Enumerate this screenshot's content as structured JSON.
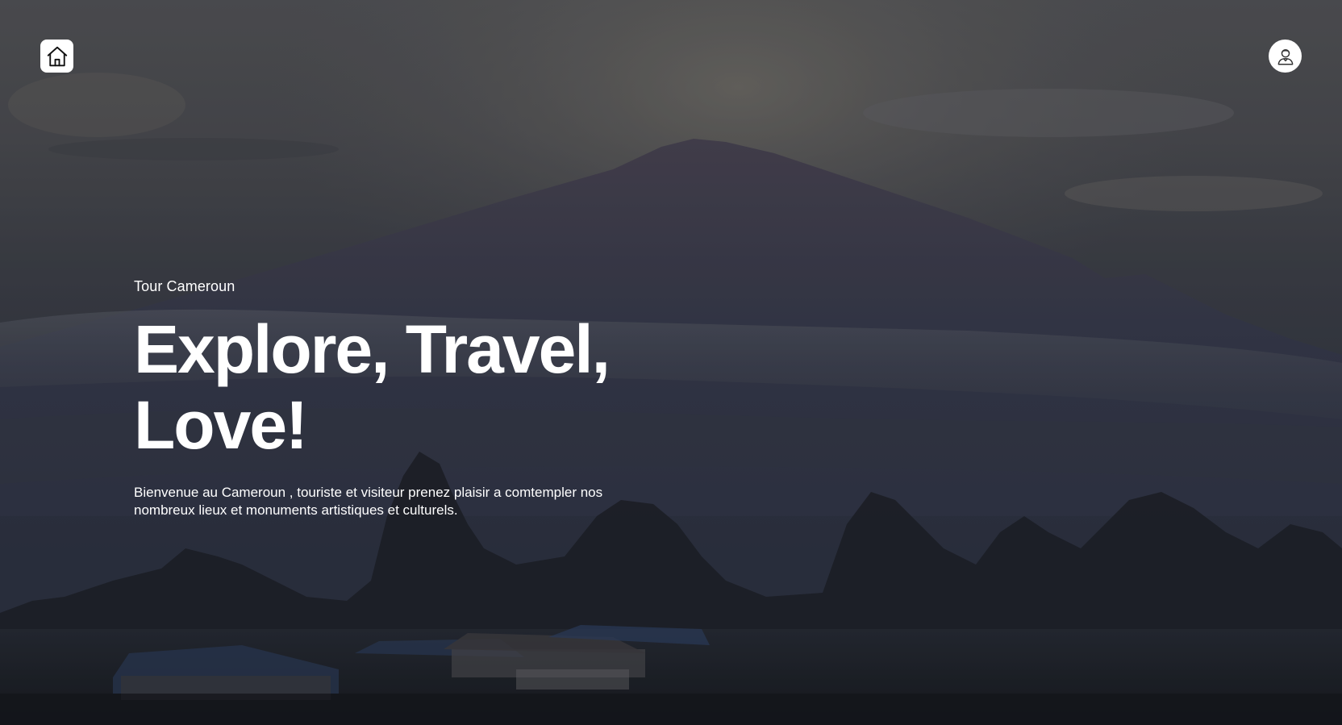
{
  "nav": {
    "home_icon": "home-icon",
    "user_icon": "user-avatar-icon"
  },
  "hero": {
    "eyebrow": "Tour Cameroun",
    "headline_line1": "Explore, Travel,",
    "headline_line2": "Love!",
    "description": "Bienvenue au Cameroun , touriste et visiteur prenez plaisir a comtempler nos nombreux lieux et monuments artistiques et culturels."
  },
  "colors": {
    "text": "#ffffff",
    "button_bg": "#ffffff",
    "sky": "#545558",
    "mountain": "#2f3545",
    "trees": "#1a1d22"
  }
}
